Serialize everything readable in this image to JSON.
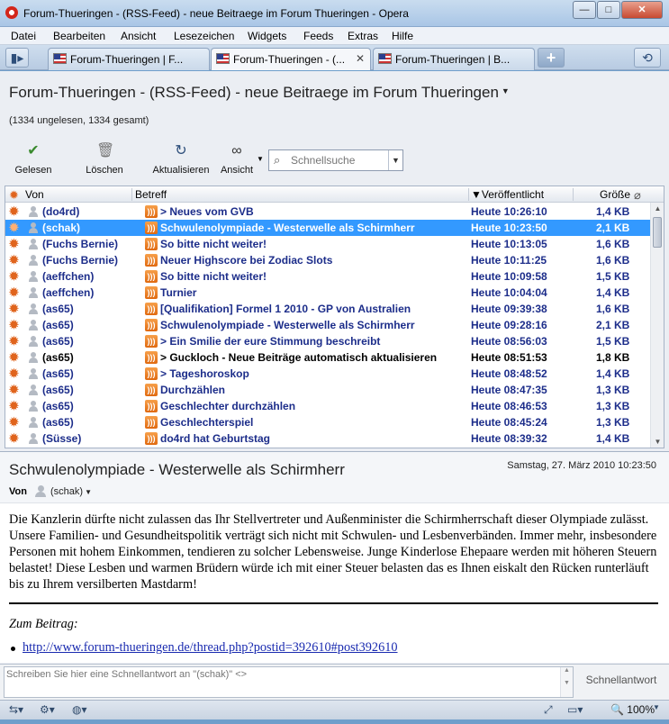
{
  "window": {
    "title": "Forum-Thueringen - (RSS-Feed) - neue Beitraege im Forum Thueringen - Opera",
    "minimize": "—",
    "maximize": "□",
    "close": "✕"
  },
  "menu": [
    "Datei",
    "Bearbeiten",
    "Ansicht",
    "Lesezeichen",
    "Widgets",
    "Feeds",
    "Extras",
    "Hilfe"
  ],
  "tabs": [
    {
      "label": "Forum-Thueringen | F..."
    },
    {
      "label": "Forum-Thueringen - (...",
      "close": "✕"
    },
    {
      "label": "Forum-Thueringen | B..."
    }
  ],
  "feed": {
    "title": "Forum-Thueringen - (RSS-Feed) - neue Beitraege im Forum Thueringen",
    "counts": "(1334 ungelesen, 1334 gesamt)"
  },
  "toolbar": {
    "read": "Gelesen",
    "delete": "Löschen",
    "refresh": "Aktualisieren",
    "view": "Ansicht",
    "search_placeholder": "Schnellsuche"
  },
  "columns": {
    "from": "Von",
    "subject": "Betreff",
    "published": "▼Veröffentlicht",
    "size": "Größe"
  },
  "messages": [
    {
      "from": "(do4rd)",
      "subject": "> Neues vom GVB",
      "date": "Heute 10:26:10",
      "size": "1,4 KB"
    },
    {
      "from": "(schak)",
      "subject": "Schwulenolympiade - Westerwelle als Schirmherr",
      "date": "Heute 10:23:50",
      "size": "2,1 KB"
    },
    {
      "from": "(Fuchs Bernie)",
      "subject": "So bitte nicht weiter!",
      "date": "Heute 10:13:05",
      "size": "1,6 KB"
    },
    {
      "from": "(Fuchs Bernie)",
      "subject": "Neuer Highscore bei Zodiac Slots",
      "date": "Heute 10:11:25",
      "size": "1,6 KB"
    },
    {
      "from": "(aeffchen)",
      "subject": "So bitte nicht weiter!",
      "date": "Heute 10:09:58",
      "size": "1,5 KB"
    },
    {
      "from": "(aeffchen)",
      "subject": "Turnier",
      "date": "Heute 10:04:04",
      "size": "1,4 KB"
    },
    {
      "from": "(as65)",
      "subject": "[Qualifikation] Formel 1 2010 - GP von Australien",
      "date": "Heute 09:39:38",
      "size": "1,6 KB"
    },
    {
      "from": "(as65)",
      "subject": "Schwulenolympiade - Westerwelle als Schirmherr",
      "date": "Heute 09:28:16",
      "size": "2,1 KB"
    },
    {
      "from": "(as65)",
      "subject": "> Ein Smilie der eure Stimmung beschreibt",
      "date": "Heute 08:56:03",
      "size": "1,5 KB"
    },
    {
      "from": "(as65)",
      "subject": "> Guckloch - Neue Beiträge automatisch aktualisieren",
      "date": "Heute 08:51:53",
      "size": "1,8 KB"
    },
    {
      "from": "(as65)",
      "subject": "> Tageshoroskop",
      "date": "Heute 08:48:52",
      "size": "1,4 KB"
    },
    {
      "from": "(as65)",
      "subject": "Durchzählen",
      "date": "Heute 08:47:35",
      "size": "1,3 KB"
    },
    {
      "from": "(as65)",
      "subject": "Geschlechter durchzählen",
      "date": "Heute 08:46:53",
      "size": "1,3 KB"
    },
    {
      "from": "(as65)",
      "subject": "Geschlechterspiel",
      "date": "Heute 08:45:24",
      "size": "1,3 KB"
    },
    {
      "from": "(Süsse)",
      "subject": "do4rd hat Geburtstag",
      "date": "Heute 08:39:32",
      "size": "1,4 KB"
    }
  ],
  "message": {
    "subject": "Schwulenolympiade - Westerwelle als Schirmherr",
    "date": "Samstag, 27. März 2010 10:23:50",
    "from_label": "Von",
    "from": "(schak)",
    "body": "Die Kanzlerin dürfte nicht zulassen das Ihr Stellvertreter und Außenminister die Schirmherrschaft dieser Olympiade zulässt. Unsere Familien- und Gesundheitspolitik verträgt sich nicht mit Schwulen- und Lesbenverbänden. Immer mehr, insbesondere Personen mit hohem Einkommen, tendieren zu solcher Lebensweise. Junge Kinderlose Ehepaare werden mit höheren Steuern belastet! Diese Lesben und warmen Brüdern würde ich mit einer Steuer belasten das es Ihnen eiskalt den Rücken runterläuft bis zu Ihrem versilberten Mastdarm!",
    "to_post": "Zum Beitrag:",
    "link": "http://www.forum-thueringen.de/thread.php?postid=392610#post392610"
  },
  "reply": {
    "placeholder": "Schreiben Sie hier eine Schnellantwort an \"(schak)\" <>",
    "button": "Schnellantwort"
  },
  "status": {
    "zoom": "100%"
  }
}
